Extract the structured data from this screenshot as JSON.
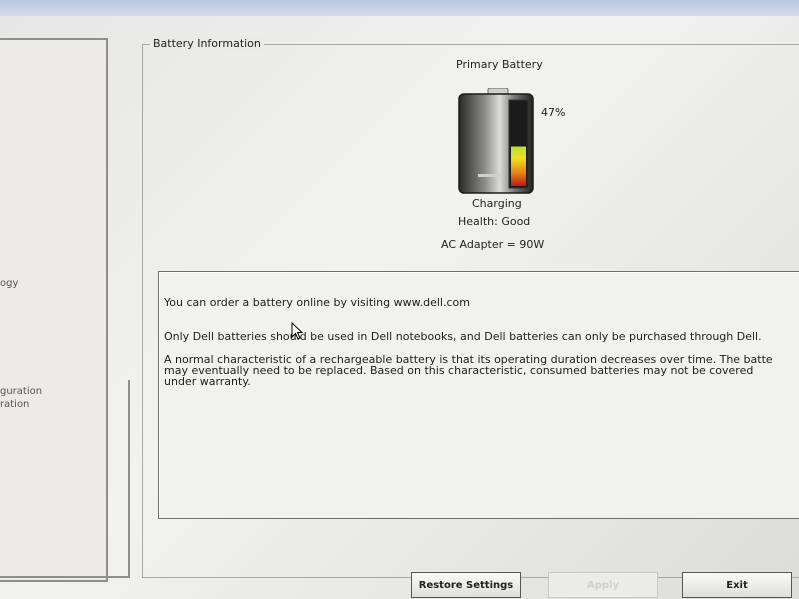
{
  "sidebar": {
    "items": [
      {
        "label": "ogy"
      },
      {
        "label": "guration"
      },
      {
        "label": "ration"
      }
    ]
  },
  "battery_info": {
    "group_title": "Battery Information",
    "battery_name": "Primary Battery",
    "charge_percent_label": "47%",
    "charge_level": 0.47,
    "status": "Charging",
    "health": "Health: Good",
    "ac_adapter": "AC Adapter = 90W"
  },
  "info_text": {
    "line1": "You can order a battery online by visiting www.dell.com",
    "line2": "Only Dell batteries should be used in Dell notebooks, and Dell batteries can only be purchased through Dell.",
    "line3a": "A normal characteristic of a rechargeable battery is that its operating duration decreases over time.  The batte",
    "line3b": "may eventually need to be replaced.  Based on this characteristic, consumed batteries may not be covered",
    "line3c": "under warranty."
  },
  "buttons": {
    "restore": "Restore Settings",
    "apply": "Apply",
    "exit": "Exit"
  },
  "icons": [
    "battery-icon",
    "mouse-cursor-icon"
  ]
}
